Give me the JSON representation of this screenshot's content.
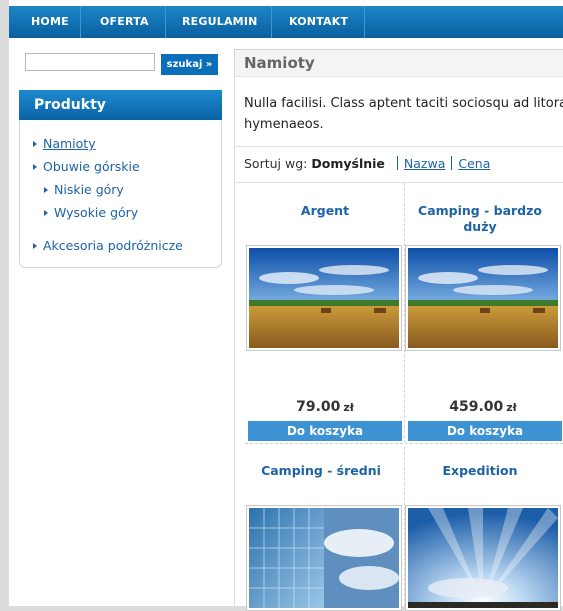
{
  "nav": {
    "items": [
      "HOME",
      "OFERTA",
      "REGULAMIN",
      "KONTAKT"
    ]
  },
  "search": {
    "value": "",
    "button_label": "szukaj »"
  },
  "sidebar": {
    "title": "Produkty",
    "items": [
      {
        "label": "Namioty",
        "level": 0,
        "active": true
      },
      {
        "label": "Obuwie górskie",
        "level": 0,
        "active": false
      },
      {
        "label": "Niskie góry",
        "level": 1,
        "active": false
      },
      {
        "label": "Wysokie góry",
        "level": 1,
        "active": false
      },
      {
        "label": "Akcesoria podróżnicze",
        "level": 0,
        "active": false
      }
    ]
  },
  "main": {
    "title": "Namioty",
    "description_line1": "Nulla facilisi. Class aptent taciti sociosqu ad litora",
    "description_line2": "hymenaeos."
  },
  "sort": {
    "label": "Sortuj wg:",
    "current": "Domyślnie",
    "options": [
      "Nazwa",
      "Cena"
    ]
  },
  "products": [
    {
      "name_line1": "Argent",
      "name_line2": "",
      "price": "79.00",
      "currency": "zł",
      "cart_label": "Do koszyka",
      "image": "field"
    },
    {
      "name_line1": "Camping - bardzo",
      "name_line2": "duży",
      "price": "459.00",
      "currency": "zł",
      "cart_label": "Do koszyka",
      "image": "field"
    },
    {
      "name_line1": "Camping - średni",
      "name_line2": "",
      "price": "",
      "currency": "",
      "cart_label": "",
      "image": "glass-building"
    },
    {
      "name_line1": "Expedition",
      "name_line2": "",
      "price": "",
      "currency": "",
      "cart_label": "",
      "image": "sun-rays"
    }
  ]
}
